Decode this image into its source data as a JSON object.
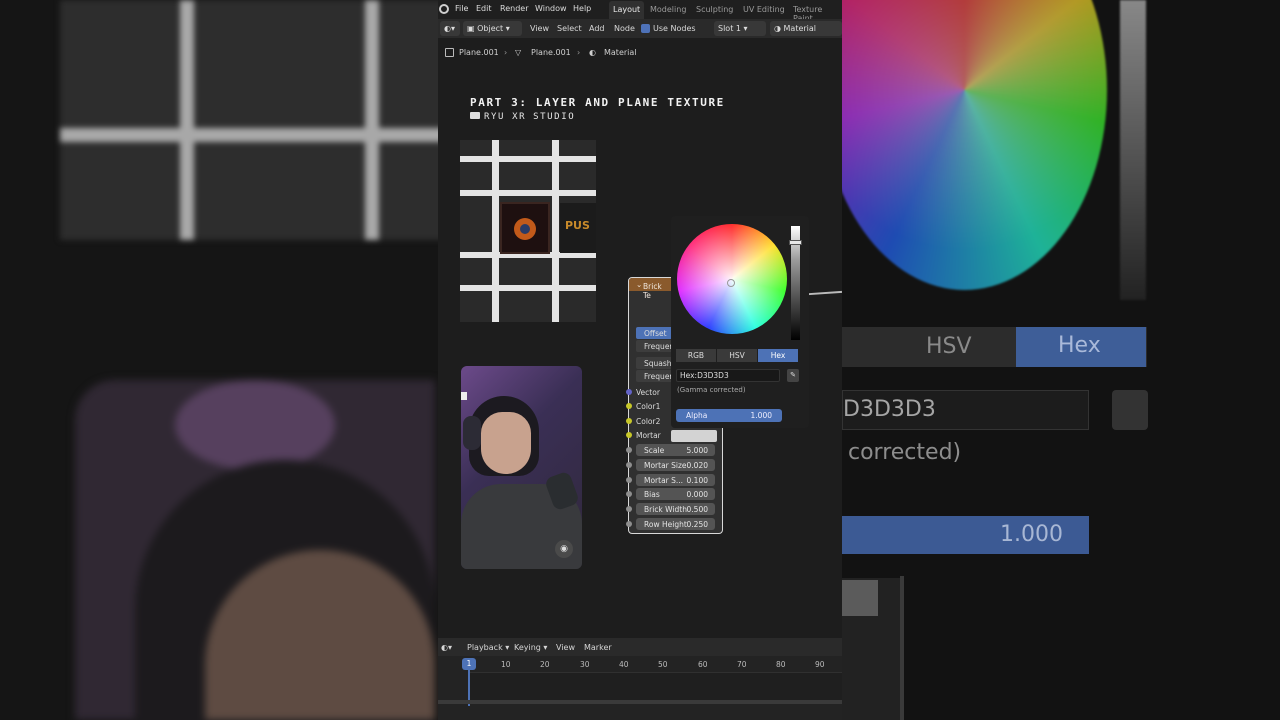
{
  "topbar": {
    "menus": [
      "File",
      "Edit",
      "Render",
      "Window",
      "Help"
    ],
    "workspaces": [
      "Layout",
      "Modeling",
      "Sculpting",
      "UV Editing",
      "Texture Paint"
    ],
    "active_workspace": "Layout"
  },
  "header": {
    "mode": "Object",
    "menus": [
      "View",
      "Select",
      "Add",
      "Node"
    ],
    "use_nodes_label": "Use Nodes",
    "slot": "Slot 1",
    "material": "Material"
  },
  "breadcrumb": [
    "Plane.001",
    "Plane.001",
    "Material"
  ],
  "overlay": {
    "title": "PART 3: LAYER AND PLANE TEXTURE",
    "subtitle": "RYU XR STUDIO"
  },
  "preview": {
    "poster_text": "PUS"
  },
  "node": {
    "title": "Brick Te",
    "offset_label": "Offset",
    "frequency_label": "Frequer",
    "squash_label": "Squash",
    "frequency2_label": "Frequer",
    "inputs": [
      "Vector",
      "Color1",
      "Color2",
      "Mortar"
    ],
    "mortar_color": "#D3D3D3",
    "fields": [
      {
        "name": "Scale",
        "value": "5.000"
      },
      {
        "name": "Mortar Size",
        "value": "0.020"
      },
      {
        "name": "Mortar S...",
        "value": "0.100"
      },
      {
        "name": "Bias",
        "value": "0.000"
      },
      {
        "name": "Brick Width",
        "value": "0.500"
      },
      {
        "name": "Row Height",
        "value": "0.250"
      }
    ]
  },
  "color_picker": {
    "tabs": [
      "RGB",
      "HSV",
      "Hex"
    ],
    "active_tab": "Hex",
    "hex_value": "Hex:D3D3D3",
    "note": "(Gamma corrected)",
    "alpha_label": "Alpha",
    "alpha_value": "1.000"
  },
  "background_right": {
    "tab_hsv": "HSV",
    "tab_hex": "Hex",
    "hex_partial": "D3D3D3",
    "corrected_partial": "corrected)",
    "alpha_partial": "1.000"
  },
  "timeline": {
    "menus": [
      "Playback",
      "Keying",
      "View",
      "Marker"
    ],
    "current_frame": "1",
    "ticks": [
      "10",
      "20",
      "30",
      "40",
      "50",
      "60",
      "70",
      "80",
      "90"
    ]
  },
  "colors": {
    "accent": "#4d72b6",
    "node_header": "#8a5a2c",
    "socket_yellow": "#c7c729",
    "socket_purple": "#6363c7"
  }
}
